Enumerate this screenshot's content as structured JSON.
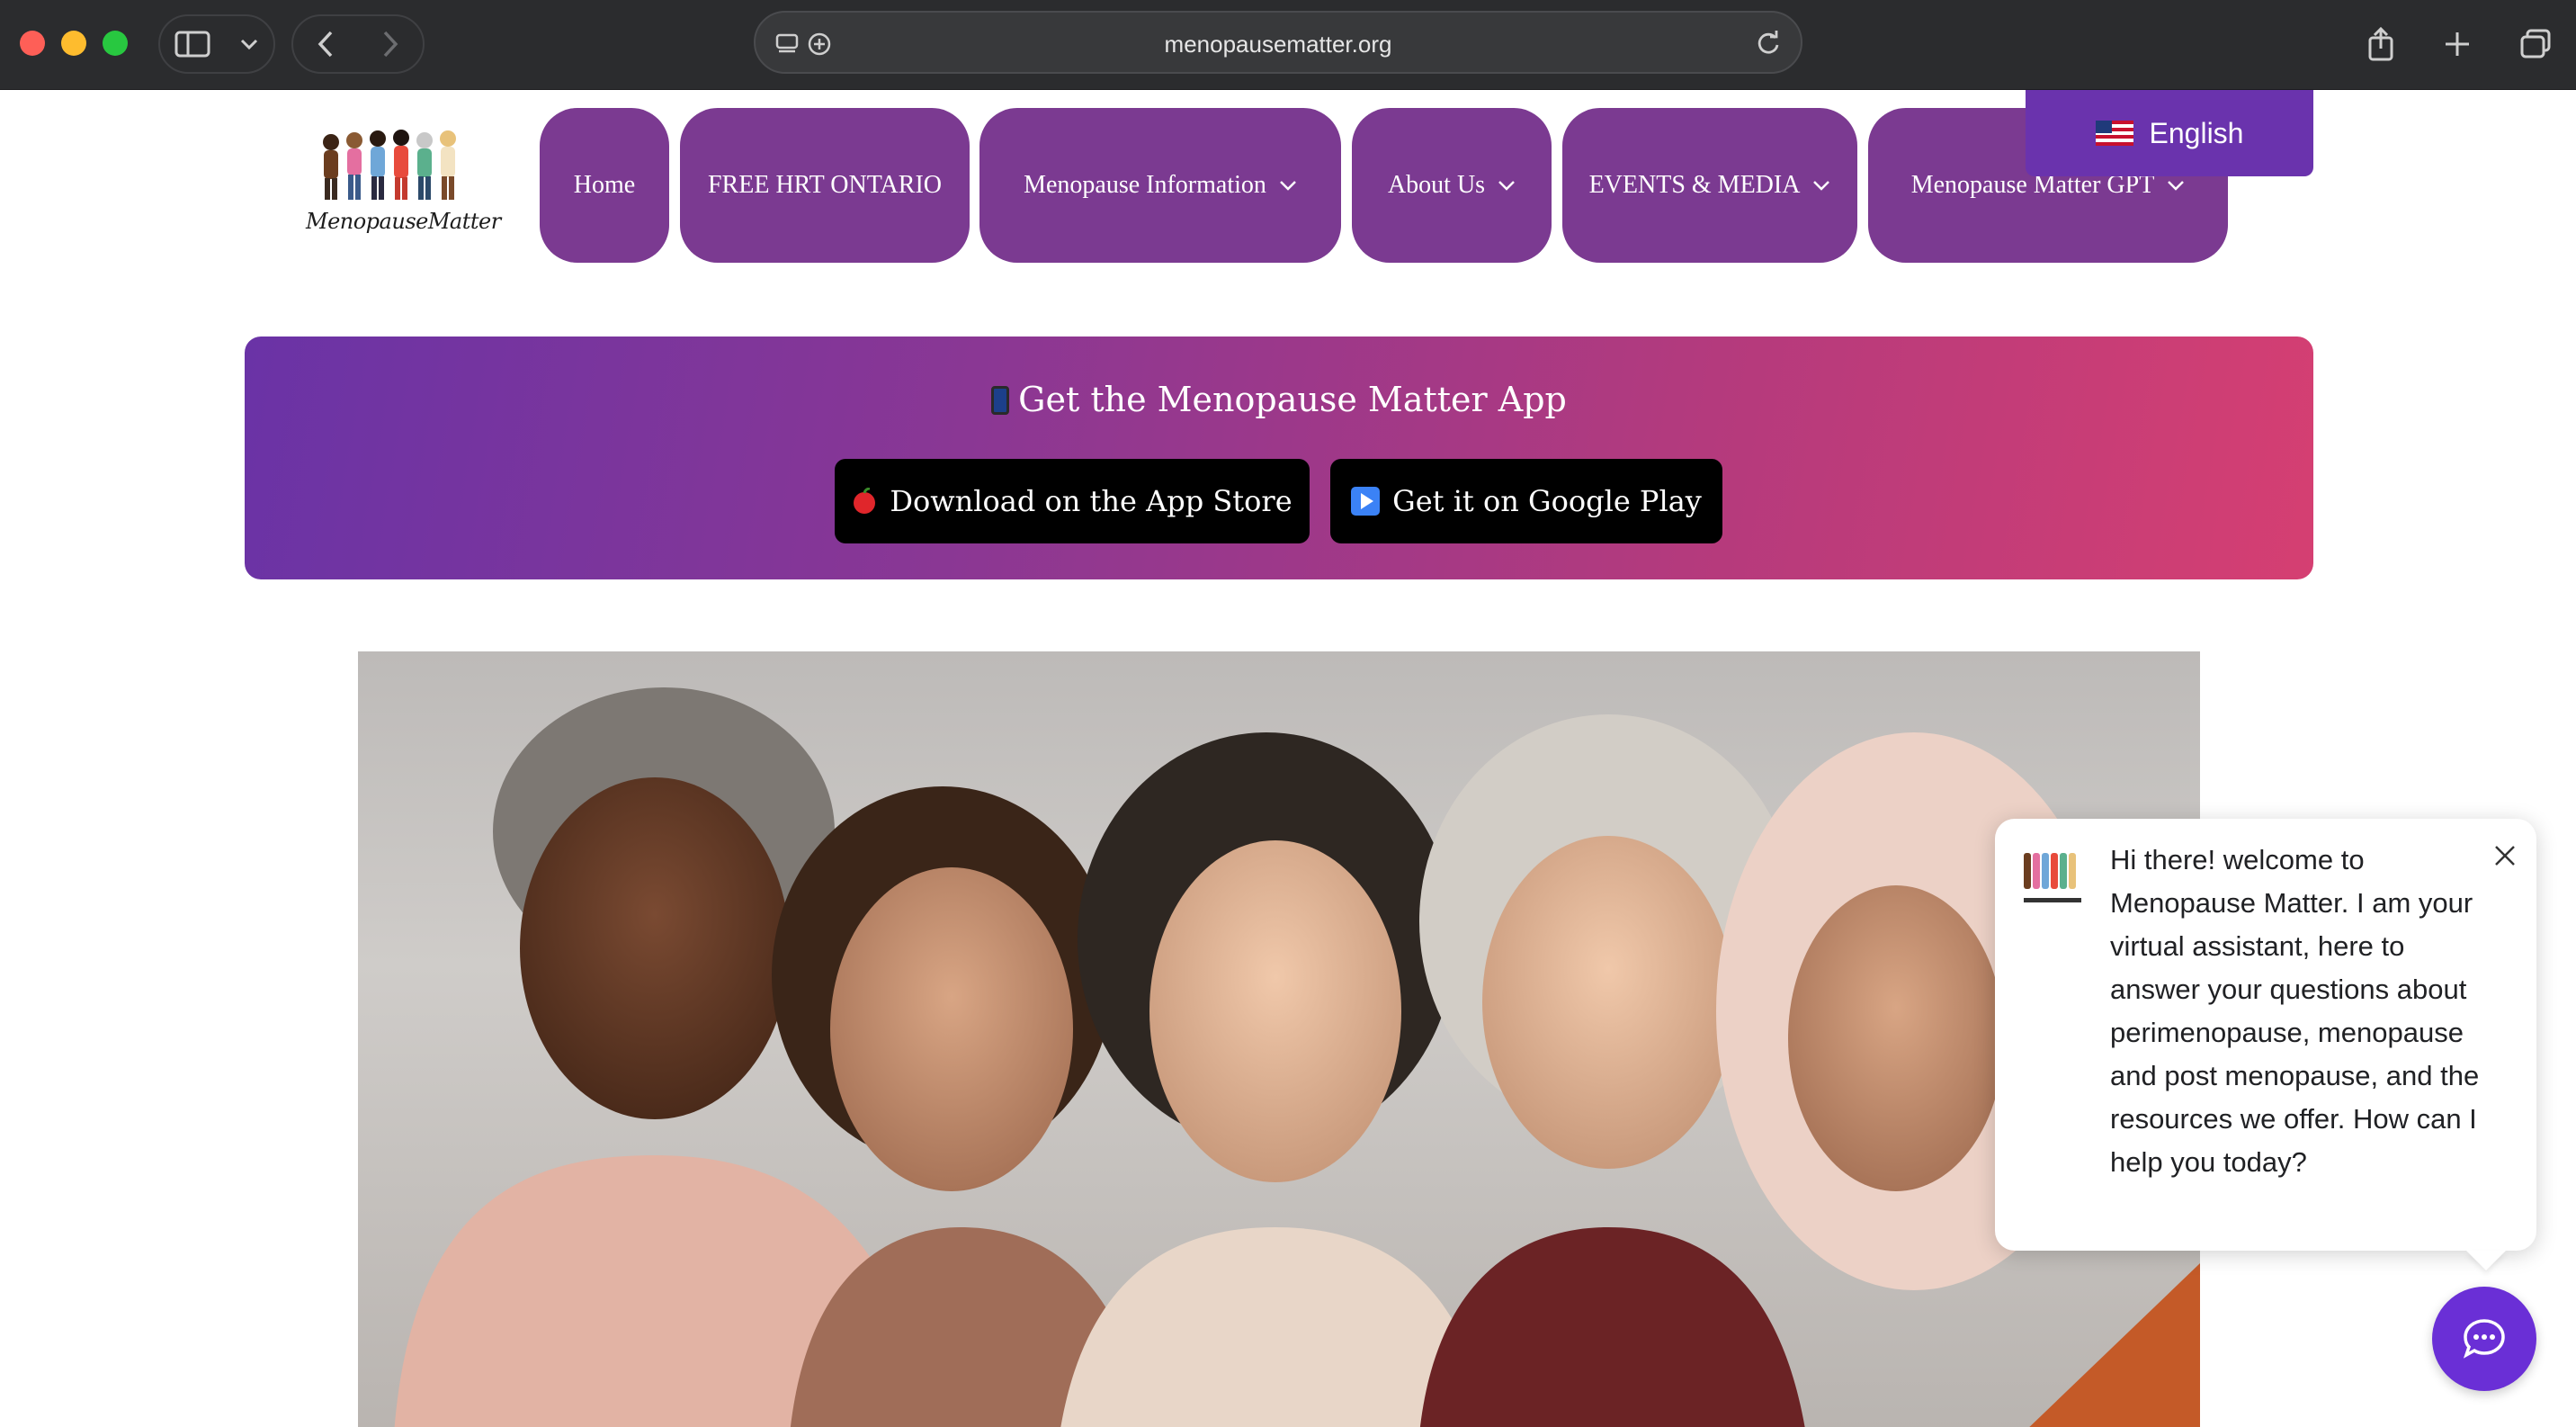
{
  "browser": {
    "url": "menopausematter.org"
  },
  "site": {
    "logo_text": "MenopauseMatter"
  },
  "nav": {
    "items": [
      {
        "label": "Home",
        "has_dropdown": false
      },
      {
        "label": "FREE HRT ONTARIO",
        "has_dropdown": false
      },
      {
        "label": "Menopause Information",
        "has_dropdown": true
      },
      {
        "label": "About Us",
        "has_dropdown": true
      },
      {
        "label": "EVENTS & MEDIA",
        "has_dropdown": true
      },
      {
        "label": "Menopause Matter GPT",
        "has_dropdown": true
      }
    ]
  },
  "language": {
    "selected": "English",
    "flag_icon": "us-flag-icon"
  },
  "app_banner": {
    "title": "Get the Menopause Matter App",
    "title_icon": "phone-emoji",
    "app_store_label": "Download on the App Store",
    "google_play_label": "Get it on Google Play"
  },
  "chat": {
    "message": "Hi there! welcome to Menopause Matter. I am your virtual assistant, here to answer your questions about perimenopause, menopause and post menopause, and the resources we offer. How can I help you today?"
  },
  "colors": {
    "nav_purple": "#7b3a91",
    "lang_purple": "#6a33ad",
    "banner_start": "#6a33a6",
    "banner_end": "#d53f72",
    "chat_fab": "#6a2fd6"
  }
}
